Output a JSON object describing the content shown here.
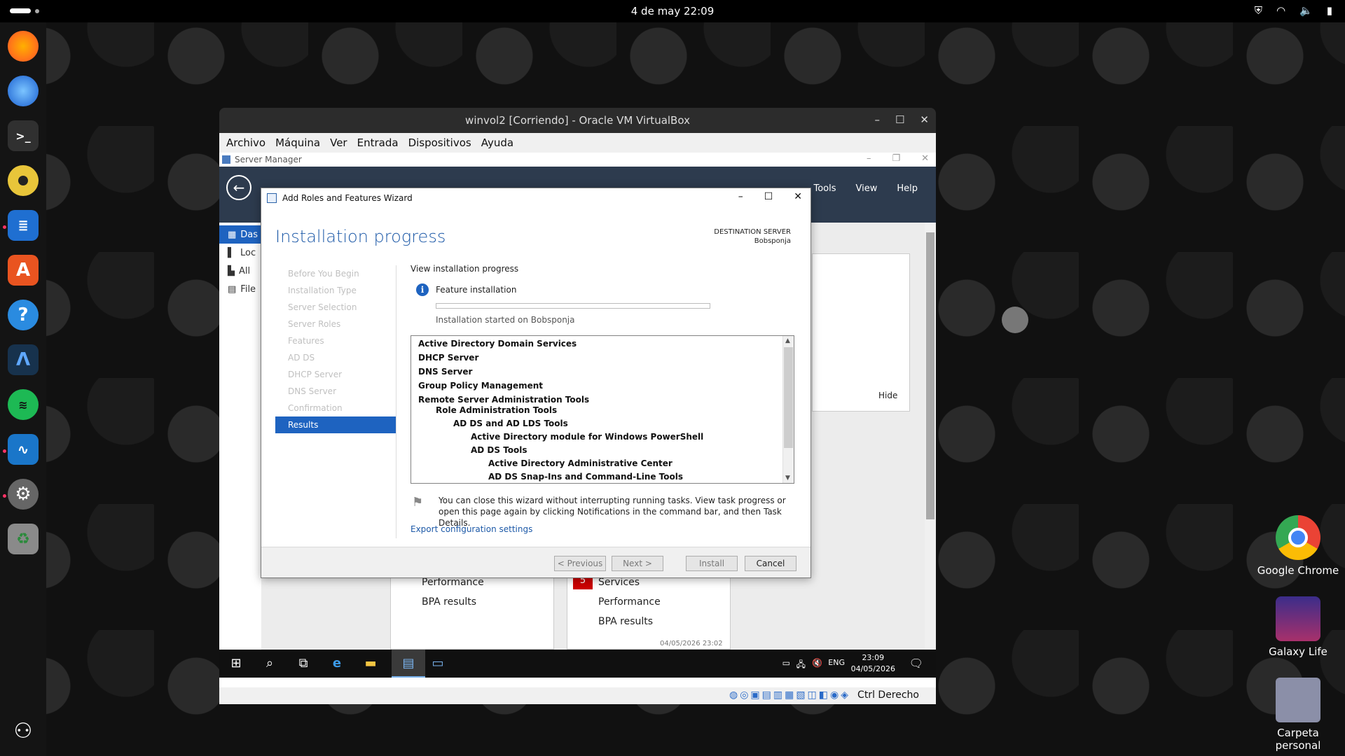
{
  "topbar": {
    "clock": "4 de may  22:09",
    "tray_icons": [
      "shield-icon",
      "wifi-icon",
      "volume-icon",
      "battery-icon"
    ]
  },
  "dock": {
    "apps": [
      {
        "name": "firefox",
        "color": "#ff7139"
      },
      {
        "name": "thunderbird",
        "color": "#2d7ff9"
      },
      {
        "name": "terminal",
        "color": "#303030"
      },
      {
        "name": "rhythmbox",
        "color": "#e0b020"
      },
      {
        "name": "writer",
        "color": "#1f6fd1"
      },
      {
        "name": "app-center",
        "color": "#e95420"
      },
      {
        "name": "help",
        "color": "#2a8be0"
      },
      {
        "name": "anydesk",
        "color": "#17324d"
      },
      {
        "name": "spotify",
        "color": "#1db954"
      },
      {
        "name": "system-monitor",
        "color": "#1a76c9"
      },
      {
        "name": "settings",
        "color": "#777777"
      },
      {
        "name": "trash",
        "color": "#8a8a8a"
      }
    ]
  },
  "desktop_icons": [
    {
      "label": "Google Chrome"
    },
    {
      "label": "Galaxy Life"
    },
    {
      "label": "Carpeta personal"
    }
  ],
  "vbox": {
    "title": "winvol2 [Corriendo] - Oracle VM VirtualBox",
    "menu": [
      "Archivo",
      "Máquina",
      "Ver",
      "Entrada",
      "Dispositivos",
      "Ayuda"
    ],
    "status_text": "Ctrl Derecho"
  },
  "server_manager": {
    "title": "Server Manager",
    "header_menus": [
      "Tools",
      "View",
      "Help"
    ],
    "nav": [
      "Das",
      "Loc",
      "All",
      "File"
    ],
    "tile_hide": "Hide",
    "tile_left": [
      "Performance",
      "BPA results"
    ],
    "tile_right_badge": "5",
    "tile_right": [
      "Services",
      "Performance",
      "BPA results"
    ],
    "timestamp": "04/05/2026 23:02"
  },
  "taskbar": {
    "lang": "ENG",
    "time": "23:09",
    "date": "04/05/2026"
  },
  "wizard": {
    "title": "Add Roles and Features Wizard",
    "heading": "Installation progress",
    "dest_label": "DESTINATION SERVER",
    "dest_server": "Bobsponja",
    "steps": [
      "Before You Begin",
      "Installation Type",
      "Server Selection",
      "Server Roles",
      "Features",
      "AD DS",
      "DHCP Server",
      "DNS Server",
      "Confirmation",
      "Results"
    ],
    "view_label": "View installation progress",
    "feature_label": "Feature installation",
    "progress": 0.0,
    "started_text": "Installation started on Bobsponja",
    "results": [
      {
        "text": "Active Directory Domain Services",
        "level": 0
      },
      {
        "text": "DHCP Server",
        "level": 0
      },
      {
        "text": "DNS Server",
        "level": 0
      },
      {
        "text": "Group Policy Management",
        "level": 0
      },
      {
        "text": "Remote Server Administration Tools",
        "level": 0
      },
      {
        "text": "Role Administration Tools",
        "level": 1
      },
      {
        "text": "AD DS and AD LDS Tools",
        "level": 2
      },
      {
        "text": "Active Directory module for Windows PowerShell",
        "level": 3
      },
      {
        "text": "AD DS Tools",
        "level": 3
      },
      {
        "text": "Active Directory Administrative Center",
        "level": 4
      },
      {
        "text": "AD DS Snap-Ins and Command-Line Tools",
        "level": 4
      }
    ],
    "notice": "You can close this wizard without interrupting running tasks. View task progress or open this page again by clicking Notifications in the command bar, and then Task Details.",
    "export_link": "Export configuration settings",
    "buttons": {
      "previous": "< Previous",
      "next": "Next >",
      "install": "Install",
      "cancel": "Cancel"
    }
  }
}
